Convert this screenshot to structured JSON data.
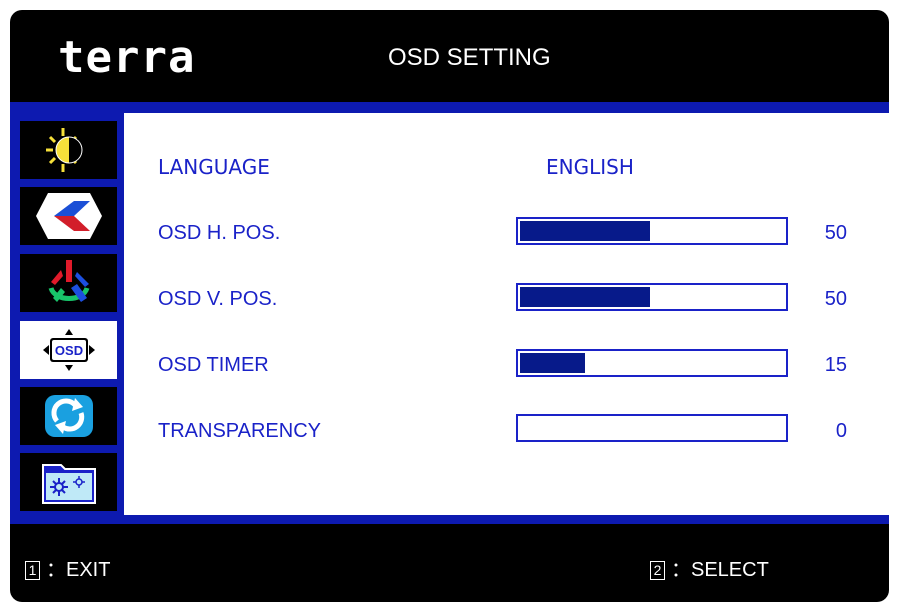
{
  "header": {
    "brand": "terra",
    "title": "OSD SETTING"
  },
  "sidebar": {
    "items": [
      {
        "icon": "brightness-icon",
        "active": false
      },
      {
        "icon": "image-position-icon",
        "active": false
      },
      {
        "icon": "color-icon",
        "active": false
      },
      {
        "icon": "osd-icon",
        "label": "OSD",
        "active": true
      },
      {
        "icon": "reset-icon",
        "active": false
      },
      {
        "icon": "misc-settings-icon",
        "active": false
      }
    ]
  },
  "settings": {
    "language": {
      "label": "LANGUAGE",
      "value": "ENGLISH"
    },
    "osd_h_pos": {
      "label": "OSD H. POS.",
      "value": "50",
      "fill": 0.5
    },
    "osd_v_pos": {
      "label": "OSD V. POS.",
      "value": "50",
      "fill": 0.5
    },
    "osd_timer": {
      "label": "OSD TIMER",
      "value": "15",
      "fill": 0.25
    },
    "transparency": {
      "label": "TRANSPARENCY",
      "value": "0",
      "fill": 0
    }
  },
  "footer": {
    "exit": {
      "key": "1",
      "label": "：EXIT"
    },
    "select": {
      "key": "2",
      "label": "：SELECT"
    }
  },
  "colors": {
    "accent_blue": "#0d1ab0",
    "text_blue": "#1a22c8",
    "bar_fill": "#071a8a",
    "background": "#000000"
  }
}
